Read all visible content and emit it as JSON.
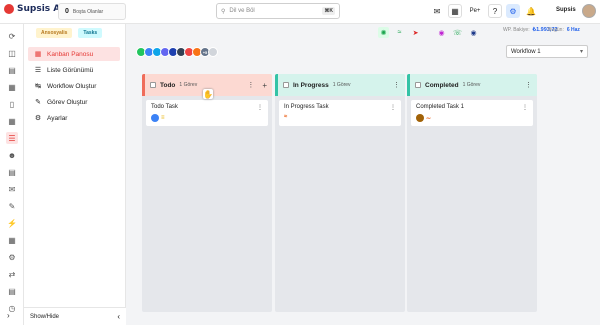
{
  "app": {
    "name": "Supsis Ai"
  },
  "header": {
    "online_count": "0",
    "online_label": "Boşta Olanlar",
    "search_value": "Dil ve Böl",
    "search_shortcut": "⌘K",
    "user_name": "Supsis",
    "notification_count": "6"
  },
  "tags": [
    {
      "label": "Ansosyalis"
    },
    {
      "label": "Tasks"
    }
  ],
  "status": {
    "wallet_label": "WP. Bakiye:",
    "wallet_value": "₺1.993,72",
    "today_label": "Bugün:",
    "today_value": "6 Haz"
  },
  "menu": {
    "items": [
      {
        "label": "Kanban Panosu",
        "icon": "kanban-icon",
        "active": true
      },
      {
        "label": "Liste Görünümü",
        "icon": "list-icon",
        "active": false
      },
      {
        "label": "Workflow Oluştur",
        "icon": "workflow-icon",
        "active": false
      },
      {
        "label": "Görev Oluştur",
        "icon": "task-icon",
        "active": false
      },
      {
        "label": "Ayarlar",
        "icon": "gear-icon",
        "active": false
      }
    ],
    "show_hide_label": "Show/Hide"
  },
  "workflow_select": {
    "value": "Workflow 1"
  },
  "columns": [
    {
      "name": "Todo",
      "count": "1 Görev",
      "color": "#ef6c5a",
      "head_bg": "#fcd9d2",
      "card": {
        "title": "Todo Task"
      }
    },
    {
      "name": "In Progress",
      "count": "1 Görev",
      "color": "#34c3a6",
      "head_bg": "#d5f3ec",
      "card": {
        "title": "In Progress Task"
      }
    },
    {
      "name": "Completed",
      "count": "1 Görev",
      "color": "#34c3a6",
      "head_bg": "#d5f3ec",
      "card": {
        "title": "Completed Task 1"
      }
    }
  ],
  "team_avatars_more": "+5"
}
